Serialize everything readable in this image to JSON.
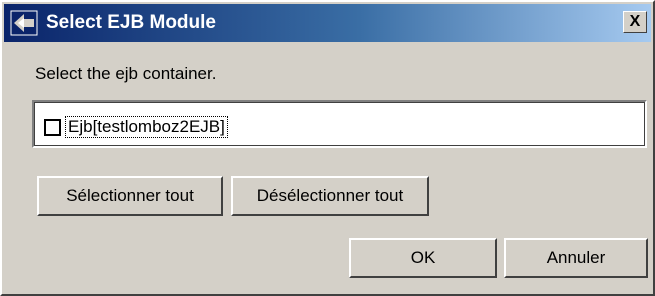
{
  "window": {
    "title": "Select EJB Module",
    "icon": "eclipse-icon",
    "close_label": "X"
  },
  "prompt": "Select the ejb container.",
  "list": {
    "items": [
      {
        "label": "Ejb[testlomboz2EJB]",
        "checked": false
      }
    ]
  },
  "buttons": {
    "select_all": "Sélectionner tout",
    "deselect_all": "Désélectionner tout",
    "ok": "OK",
    "cancel": "Annuler"
  },
  "colors": {
    "titlebar_start": "#0a246a",
    "titlebar_end": "#a6caf0",
    "dialog_background": "#d4d0c8"
  }
}
